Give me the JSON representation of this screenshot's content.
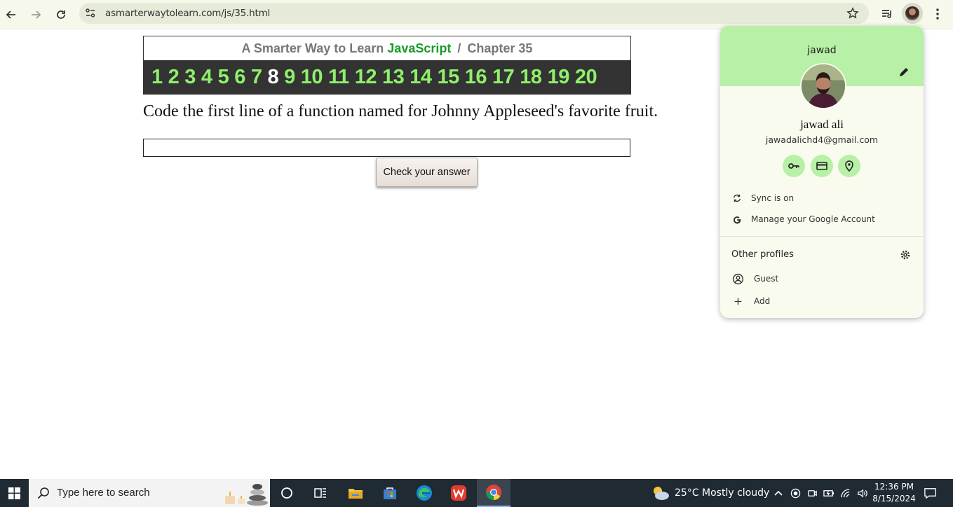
{
  "browser": {
    "url": "asmarterwaytolearn.com/js/35.html",
    "icons": [
      "back-icon",
      "forward-icon",
      "reload-icon",
      "site-settings-icon",
      "bookmark-star-icon",
      "reading-list-icon",
      "profile-avatar-icon",
      "menu-dots-icon"
    ]
  },
  "page": {
    "header": {
      "prefix": "A Smarter Way to Learn",
      "brand": "JavaScript",
      "separator": "/",
      "chapter": "Chapter 35"
    },
    "chapters": [
      "1",
      "2",
      "3",
      "4",
      "5",
      "6",
      "7",
      "8",
      "9",
      "10",
      "11",
      "12",
      "13",
      "14",
      "15",
      "16",
      "17",
      "18",
      "19",
      "20"
    ],
    "current_chapter": "8",
    "question": "Code the first line of a function named for Johnny Appleseed's favorite fruit.",
    "answer_value": "",
    "check_button": "Check your answer",
    "colors": {
      "brand": "#1a9a2a",
      "chapter_link": "#8ef06a",
      "chapter_bar": "#333333"
    }
  },
  "profile_panel": {
    "profile_name": "jawad",
    "full_name": "jawad ali",
    "email": "jawadalichd4@gmail.com",
    "quick_actions": [
      "password-key-icon",
      "payment-card-icon",
      "address-pin-icon"
    ],
    "sync": "Sync is on",
    "manage": "Manage your Google Account",
    "other_profiles": "Other profiles",
    "guest": "Guest",
    "add": "Add",
    "accent": "#b7f0a6"
  },
  "taskbar": {
    "search_placeholder": "Type here to search",
    "apps": [
      "cortana-icon",
      "task-view-icon",
      "file-explorer-icon",
      "microsoft-store-icon",
      "edge-icon",
      "wps-office-icon",
      "chrome-icon"
    ],
    "weather": "25°C  Mostly cloudy",
    "time": "12:36 PM",
    "date": "8/15/2024"
  }
}
